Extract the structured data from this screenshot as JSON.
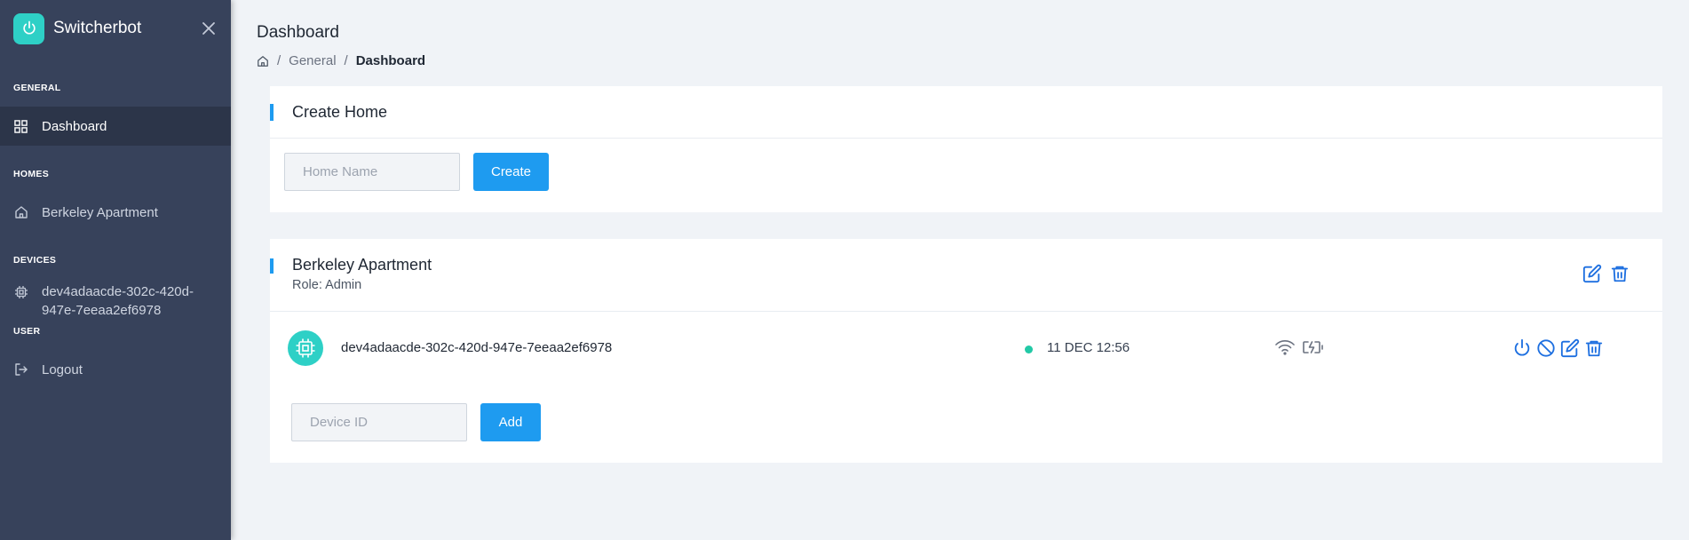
{
  "app": {
    "name": "Switcherbot"
  },
  "sidebar": {
    "sections": {
      "general": "GENERAL",
      "homes": "HOMES",
      "devices": "DEVICES",
      "user": "USER"
    },
    "items": {
      "dashboard": "Dashboard",
      "home": "Berkeley Apartment",
      "device": "dev4adaacde-302c-420d-947e-7eeaa2ef6978",
      "logout": "Logout"
    }
  },
  "header": {
    "title": "Dashboard",
    "breadcrumb": [
      "General",
      "Dashboard"
    ]
  },
  "create_home": {
    "title": "Create Home",
    "input_placeholder": "Home Name",
    "button_label": "Create"
  },
  "home": {
    "name": "Berkeley Apartment",
    "role": "Role: Admin",
    "device": {
      "id": "dev4adaacde-302c-420d-947e-7eeaa2ef6978",
      "status": "online",
      "last_seen": "11 DEC 12:56"
    },
    "add_device": {
      "input_placeholder": "Device ID",
      "button_label": "Add"
    }
  },
  "colors": {
    "sidebar_bg": "#37425b",
    "sidebar_active": "#2c3549",
    "accent": "#1e9bf0",
    "brand_teal": "#2ed0c6",
    "icon_blue": "#1d6fe0",
    "online_green": "#22c9a6"
  },
  "icons": [
    "power-icon",
    "close-icon",
    "grid-icon",
    "home-icon",
    "chip-icon",
    "logout-icon",
    "edit-icon",
    "trash-icon",
    "ban-icon",
    "wifi-icon",
    "battery-charging-icon"
  ]
}
